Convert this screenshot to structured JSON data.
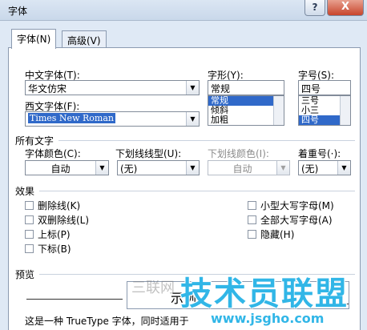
{
  "window": {
    "title": "字体",
    "help": "?",
    "close": "X"
  },
  "tabs": [
    {
      "label": "字体(N)"
    },
    {
      "label": "高级(V)"
    }
  ],
  "chinese_font": {
    "label": "中文字体(T):",
    "value": "华文仿宋"
  },
  "western_font": {
    "label": "西文字体(F):",
    "value": "Times New Roman"
  },
  "style": {
    "label": "字形(Y):",
    "value": "常规",
    "options": [
      {
        "label": "常规",
        "selected": true
      },
      {
        "label": "倾斜",
        "selected": false
      },
      {
        "label": "加粗",
        "selected": false
      }
    ]
  },
  "size": {
    "label": "字号(S):",
    "value": "四号",
    "options": [
      {
        "label": "三号",
        "selected": false
      },
      {
        "label": "小三",
        "selected": false
      },
      {
        "label": "四号",
        "selected": true
      }
    ]
  },
  "all_text": {
    "title": "所有文字",
    "font_color": {
      "label": "字体颜色(C):",
      "value": "自动"
    },
    "underline_type": {
      "label": "下划线线型(U):",
      "value": "(无)"
    },
    "underline_color": {
      "label": "下划线颜色(I):",
      "value": "自动"
    },
    "emphasis": {
      "label": "着重号(·):",
      "value": "(无)"
    }
  },
  "effects": {
    "title": "效果",
    "left": [
      {
        "label": "删除线(K)"
      },
      {
        "label": "双删除线(L)"
      },
      {
        "label": "上标(P)"
      },
      {
        "label": "下标(B)"
      }
    ],
    "right": [
      {
        "label": "小型大写字母(M)"
      },
      {
        "label": "全部大写字母(A)"
      },
      {
        "label": "隐藏(H)"
      }
    ]
  },
  "preview": {
    "title": "预览",
    "sample": "示例",
    "note": "这是一种 TrueType 字体，同时适用于"
  },
  "watermark": {
    "left": "三联网",
    "main": "技术员联盟",
    "url": "www.jsgho.com"
  }
}
